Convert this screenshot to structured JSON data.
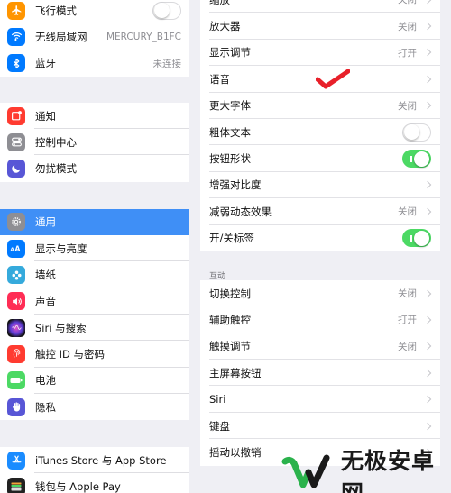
{
  "sidebar": {
    "group1": [
      {
        "label": "飞行模式",
        "icon": "airplane-icon",
        "color": "#ff9500",
        "control": "toggle-off"
      },
      {
        "label": "无线局域网",
        "icon": "wifi-icon",
        "color": "#007aff",
        "value": "MERCURY_B1FC"
      },
      {
        "label": "蓝牙",
        "icon": "bluetooth-icon",
        "color": "#007aff",
        "value": "未连接"
      }
    ],
    "group2": [
      {
        "label": "通知",
        "icon": "notifications-icon",
        "color": "#ff3b30"
      },
      {
        "label": "控制中心",
        "icon": "control-center-icon",
        "color": "#8e8e93"
      },
      {
        "label": "勿扰模式",
        "icon": "moon-icon",
        "color": "#5856d6"
      }
    ],
    "group3": [
      {
        "label": "通用",
        "icon": "gear-icon",
        "color": "#8e8e93",
        "selected": true
      },
      {
        "label": "显示与亮度",
        "icon": "display-brightness-icon",
        "color": "#007aff"
      },
      {
        "label": "墙纸",
        "icon": "wallpaper-icon",
        "color": "#35aadc"
      },
      {
        "label": "声音",
        "icon": "sound-icon",
        "color": "#ff2d55"
      },
      {
        "label": "Siri 与搜索",
        "icon": "siri-icon",
        "color": "#222222"
      },
      {
        "label": "触控 ID 与密码",
        "icon": "fingerprint-icon",
        "color": "#ff3b30"
      },
      {
        "label": "电池",
        "icon": "battery-icon",
        "color": "#4cd964"
      },
      {
        "label": "隐私",
        "icon": "hand-icon",
        "color": "#5856d6"
      }
    ],
    "group4": [
      {
        "label": "iTunes Store 与 App Store",
        "icon": "app-store-icon",
        "color": "#1a8cff"
      },
      {
        "label": "钱包与 Apple Pay",
        "icon": "wallet-icon",
        "color": "#222222"
      }
    ]
  },
  "accessibility": {
    "group1": [
      {
        "label": "缩放",
        "value": "关闭",
        "chevron": true
      },
      {
        "label": "放大器",
        "value": "关闭",
        "chevron": true
      },
      {
        "label": "显示调节",
        "value": "打开",
        "chevron": true
      },
      {
        "label": "语音",
        "value": "",
        "chevron": true
      },
      {
        "label": "更大字体",
        "value": "关闭",
        "chevron": true
      },
      {
        "label": "粗体文本",
        "toggle": "off"
      },
      {
        "label": "按钮形状",
        "toggle": "on"
      },
      {
        "label": "增强对比度",
        "value": "",
        "chevron": true
      },
      {
        "label": "减弱动态效果",
        "value": "关闭",
        "chevron": true
      },
      {
        "label": "开/关标签",
        "toggle": "on"
      }
    ],
    "interaction_header": "互动",
    "group2": [
      {
        "label": "切换控制",
        "value": "关闭",
        "chevron": true
      },
      {
        "label": "辅助触控",
        "value": "打开",
        "chevron": true
      },
      {
        "label": "触摸调节",
        "value": "关闭",
        "chevron": true
      },
      {
        "label": "主屏幕按钮",
        "value": "",
        "chevron": true
      },
      {
        "label": "Siri",
        "value": "",
        "chevron": true
      },
      {
        "label": "键盘",
        "value": "",
        "chevron": true
      },
      {
        "label": "摇动以撤销",
        "value": "",
        "chevron": true
      }
    ]
  },
  "annotation": {
    "icon": "red-checkmark-icon",
    "color": "#e8202a"
  },
  "watermark": {
    "text": "无极安卓网",
    "icon": "watermark-logo-icon",
    "color": "#2bb24c"
  }
}
